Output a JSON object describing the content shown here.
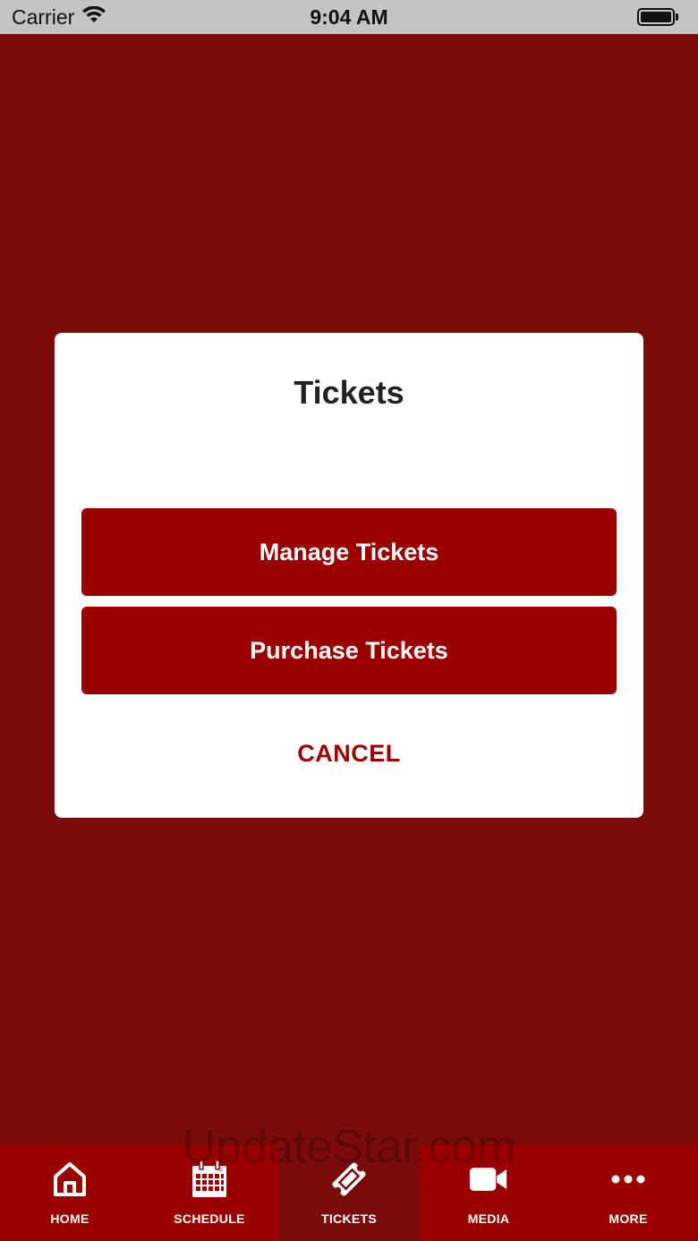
{
  "status_bar": {
    "carrier": "Carrier",
    "time": "9:04 AM"
  },
  "modal": {
    "title": "Tickets",
    "manage_label": "Manage Tickets",
    "purchase_label": "Purchase Tickets",
    "cancel_label": "CANCEL"
  },
  "tab_bar": {
    "items": [
      {
        "label": "HOME",
        "icon": "home-icon"
      },
      {
        "label": "SCHEDULE",
        "icon": "calendar-icon"
      },
      {
        "label": "TICKETS",
        "icon": "ticket-icon",
        "active": true
      },
      {
        "label": "MEDIA",
        "icon": "video-camera-icon"
      },
      {
        "label": "MORE",
        "icon": "more-dots-icon"
      }
    ]
  },
  "watermark": "UpdateStar.com",
  "colors": {
    "background": "#7a0b0b",
    "accent": "#9b0000",
    "modal": "#ffffff"
  }
}
